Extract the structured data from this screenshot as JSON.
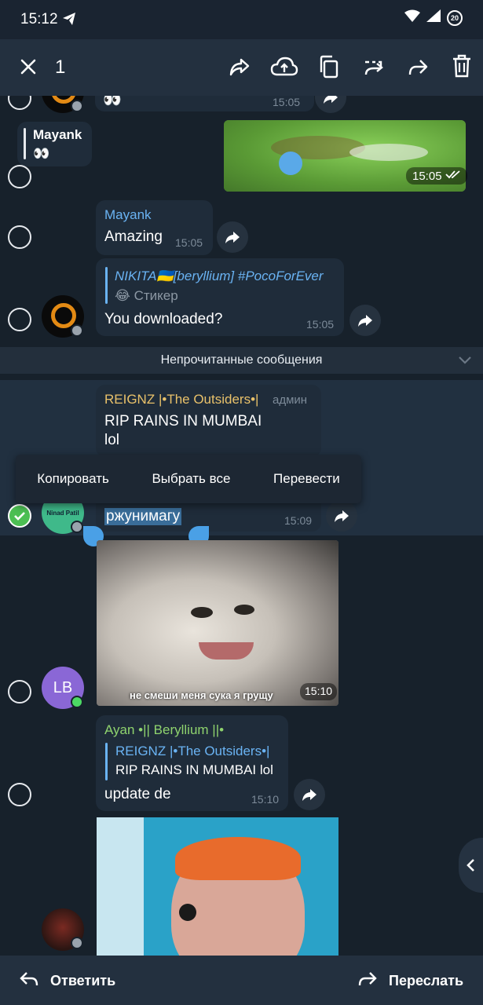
{
  "status": {
    "time": "15:12",
    "battery": "20"
  },
  "topbar": {
    "count": "1"
  },
  "messages": {
    "m0": {
      "text": "👀",
      "time": "15:05"
    },
    "m1": {
      "reply_name": "Mayank",
      "reply_text": "👀",
      "time": "15:05"
    },
    "m2": {
      "name": "Mayank",
      "text": "Amazing",
      "time": "15:05"
    },
    "m3": {
      "reply_name": "NIKITA🇺🇦[beryllium] #PocoForEver",
      "reply_text": "😂 Стикер",
      "text": "You downloaded?",
      "time": "15:05"
    },
    "m4": {
      "name": "REIGNZ |•The Outsiders•|",
      "role": "админ",
      "text1": "RIP RAINS IN MUMBAI",
      "text2": "lol"
    },
    "m5": {
      "text": "ржунимагу",
      "time": "15:09",
      "avatar_text": "Ninad Patil"
    },
    "m6": {
      "caption": "не смеши меня сука я грущу",
      "time": "15:10",
      "avatar_initials": "LB"
    },
    "m7": {
      "name": "Ayan •|| Beryllium ||•",
      "reply_name": "REIGNZ |•The Outsiders•|",
      "reply_text": "RIP RAINS IN MUMBAI lol",
      "text": "update de",
      "time": "15:10"
    }
  },
  "unread_label": "Непрочитанные сообщения",
  "context_menu": {
    "copy": "Копировать",
    "select_all": "Выбрать все",
    "translate": "Перевести"
  },
  "bottombar": {
    "reply": "Ответить",
    "forward": "Переслать"
  },
  "colors": {
    "accent": "#6ab3f3",
    "name_yellow": "#e8c16a",
    "name_green": "#8fd36e",
    "check_green": "#4cbf53",
    "lb_avatar": "#8a67d6"
  }
}
